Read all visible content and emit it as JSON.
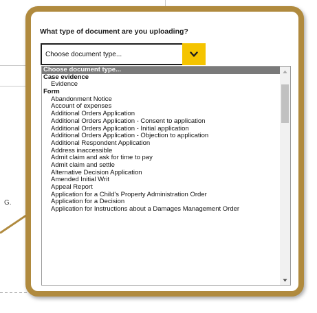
{
  "background": {
    "partial_text": "G."
  },
  "form": {
    "question": "What type of document are you uploading?",
    "select_value": "Choose document type...",
    "select_arrow_icon": "chevron-down-icon",
    "accent_color": "#f5c400",
    "callout_border_color": "#b08a3e"
  },
  "dropdown": {
    "options": [
      {
        "label": "Choose document type...",
        "kind": "selected"
      },
      {
        "label": "Case evidence",
        "kind": "group"
      },
      {
        "label": "Evidence",
        "kind": "child"
      },
      {
        "label": "Form",
        "kind": "group"
      },
      {
        "label": "Abandonment Notice",
        "kind": "child"
      },
      {
        "label": "Account of expenses",
        "kind": "child"
      },
      {
        "label": "Additional Orders Application",
        "kind": "child"
      },
      {
        "label": "Additional Orders Application - Consent to application",
        "kind": "child"
      },
      {
        "label": "Additional Orders Application - Initial application",
        "kind": "child"
      },
      {
        "label": "Additional Orders Application - Objection to application",
        "kind": "child"
      },
      {
        "label": "Additional Respondent Application",
        "kind": "child"
      },
      {
        "label": "Address inaccessible",
        "kind": "child"
      },
      {
        "label": "Admit claim and ask for time to pay",
        "kind": "child"
      },
      {
        "label": "Admit claim and settle",
        "kind": "child"
      },
      {
        "label": "Alternative Decision Application",
        "kind": "child"
      },
      {
        "label": "Amended Initial Writ",
        "kind": "child"
      },
      {
        "label": "Appeal Report",
        "kind": "child"
      },
      {
        "label": "Application for a Child's Property Administration Order",
        "kind": "child"
      },
      {
        "label": "Application for a Decision",
        "kind": "child"
      },
      {
        "label": "Application for Instructions about a Damages Management Order",
        "kind": "child"
      }
    ],
    "scroll_up_icon": "triangle-up-icon",
    "scroll_down_icon": "triangle-down-icon"
  }
}
